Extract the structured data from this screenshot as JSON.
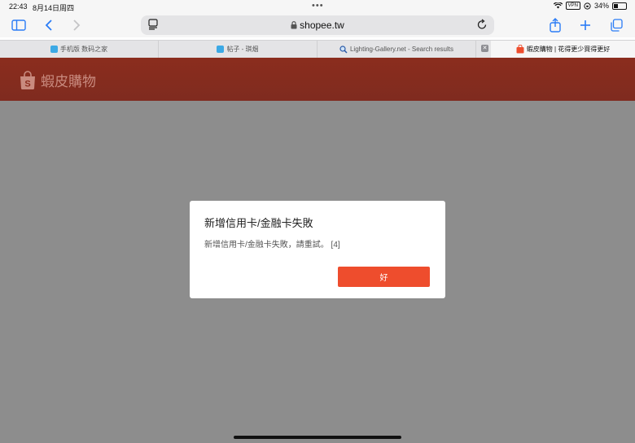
{
  "status_bar": {
    "time": "22:43",
    "date": "8月14日周四",
    "vpn_label": "VPN",
    "battery_percent": "34%",
    "battery_level": 0.34
  },
  "browser": {
    "url": "shopee.tw",
    "tabs": [
      {
        "label": "手机版 数码之家",
        "favicon": "digital-home-icon",
        "active": false
      },
      {
        "label": "帖子 - 琪烟",
        "favicon": "digital-home-icon",
        "active": false
      },
      {
        "label": "Lighting-Gallery.net - Search results",
        "favicon": "lighting-gallery-icon",
        "active": false
      },
      {
        "label": "蝦皮購物 | 花得更少買得更好",
        "favicon": "shopee-bag-icon",
        "active": true
      }
    ],
    "tab_close_glyph": "✕"
  },
  "site": {
    "logo_text": "蝦皮購物",
    "brand_color": "#ee4d2d"
  },
  "dialog": {
    "title": "新增信用卡/金融卡失敗",
    "message": "新增信用卡/金融卡失敗，請重試。 [4]",
    "ok_label": "好"
  }
}
